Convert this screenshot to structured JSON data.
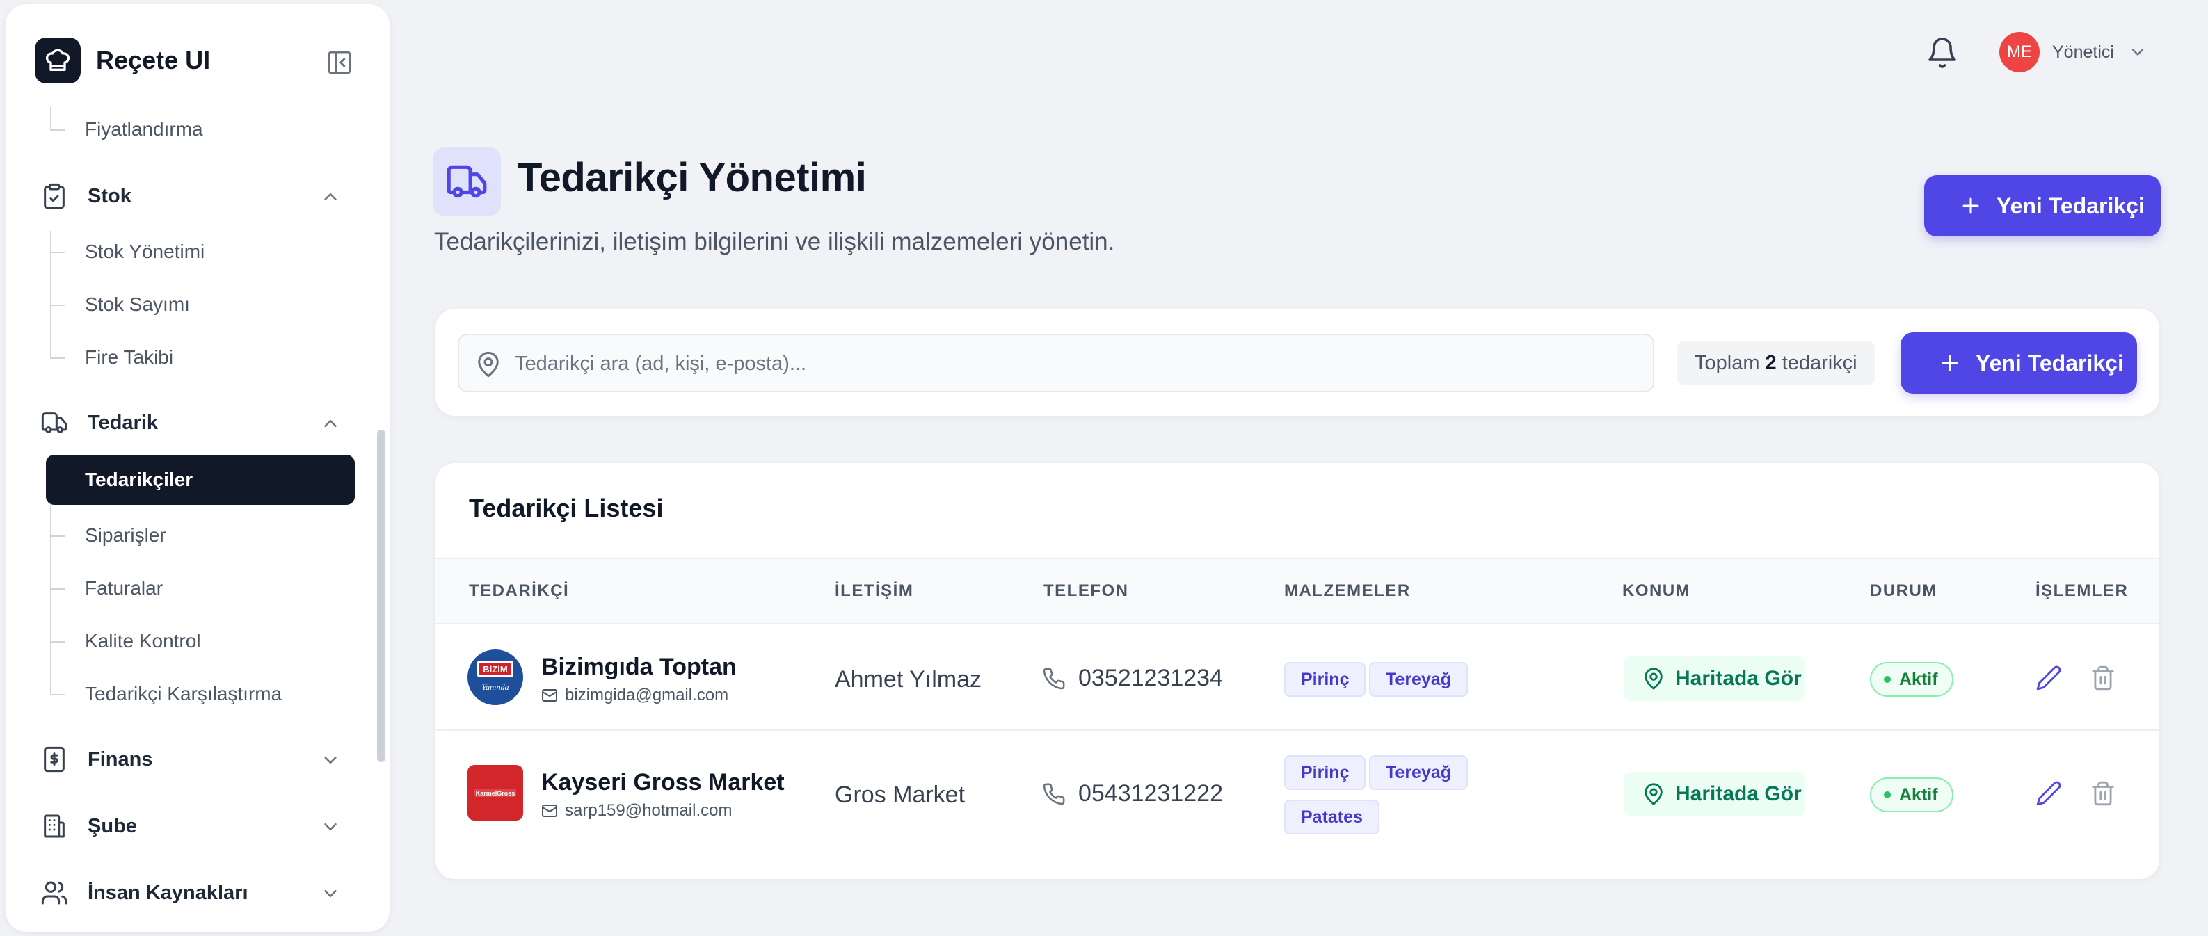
{
  "app": {
    "name": "Reçete UI"
  },
  "sidebar": {
    "items": {
      "fiyat": "Fiyatlandırma",
      "stok": "Stok",
      "stok_yonetimi": "Stok Yönetimi",
      "stok_sayimi": "Stok Sayımı",
      "fire": "Fire Takibi",
      "tedarik": "Tedarik",
      "tedarikciler": "Tedarikçiler",
      "siparisler": "Siparişler",
      "faturalar": "Faturalar",
      "kalite": "Kalite Kontrol",
      "karsilastirma": "Tedarikçi Karşılaştırma",
      "finans": "Finans",
      "sube": "Şube",
      "ik": "İnsan Kaynakları"
    }
  },
  "header": {
    "avatar_initials": "ME",
    "user_name": "Yönetici"
  },
  "page": {
    "title": "Tedarikçi Yönetimi",
    "subtitle": "Tedarikçilerinizi, iletişim bilgilerini ve ilişkili malzemeleri yönetin.",
    "new_button": "Yeni Tedarikçi"
  },
  "search": {
    "placeholder": "Tedarikçi ara (ad, kişi, e-posta)...",
    "value": "",
    "total_prefix": "Toplam",
    "total_count": "2",
    "total_suffix": "tedarikçi",
    "new_button": "Yeni Tedarikçi"
  },
  "table": {
    "title": "Tedarikçi Listesi",
    "columns": {
      "supplier": "TEDARİKÇİ",
      "contact": "İLETİŞİM",
      "phone": "TELEFON",
      "materials": "MALZEMELER",
      "location": "KONUM",
      "status": "DURUM",
      "actions": "İŞLEMLER"
    },
    "map_label": "Haritada Gör",
    "rows": [
      {
        "name": "Bizimgıda Toptan",
        "email": "bizimgida@gmail.com",
        "logo_text": "BİZİM",
        "logo_sub": "Yanında",
        "contact": "Ahmet Yılmaz",
        "phone": "03521231234",
        "materials": [
          "Pirinç",
          "Tereyağ"
        ],
        "status": "Aktif"
      },
      {
        "name": "Kayseri Gross Market",
        "email": "sarp159@hotmail.com",
        "logo_text": "KarmelGross",
        "contact": "Gros Market",
        "phone": "05431231222",
        "materials": [
          "Pirinç",
          "Tereyağ",
          "Patates"
        ],
        "status": "Aktif"
      }
    ]
  },
  "colors": {
    "accent": "#4f46e5",
    "sidebar_active": "#111827",
    "status_green": "#15803d",
    "avatar": "#ef4444"
  }
}
